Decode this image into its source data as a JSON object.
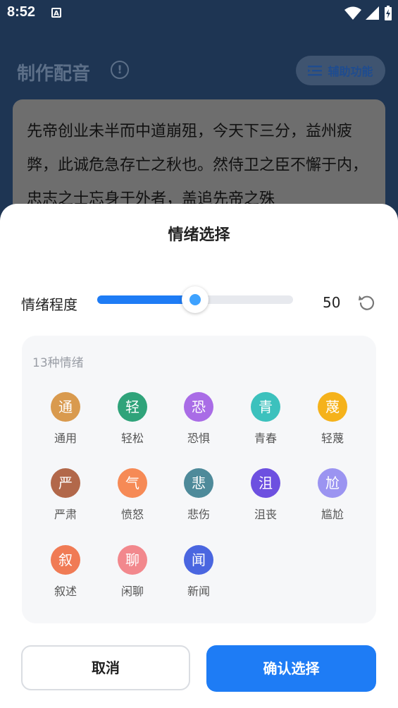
{
  "status_bar": {
    "time": "8:52",
    "notification_letter": "A"
  },
  "header": {
    "title": "制作配音",
    "assist_label": "辅助功能"
  },
  "script": {
    "text": "先帝创业未半而中道崩殂，今天下三分，益州疲弊，此诚危急存亡之秋也。然侍卫之臣不懈于内，忠志之士忘身于外者，盖追先帝之殊"
  },
  "sheet": {
    "title": "情绪选择",
    "intensity_label": "情绪程度",
    "intensity_value": "50",
    "intensity_fraction": 0.5,
    "emotion_count": "13种情绪",
    "emotions": [
      {
        "char": "通",
        "label": "通用",
        "color": "#d99a4e"
      },
      {
        "char": "轻",
        "label": "轻松",
        "color": "#2fa37a"
      },
      {
        "char": "恐",
        "label": "恐惧",
        "color": "#a96ce6"
      },
      {
        "char": "青",
        "label": "青春",
        "color": "#3cc1bd"
      },
      {
        "char": "蔑",
        "label": "轻蔑",
        "color": "#f5b21b"
      },
      {
        "char": "严",
        "label": "严肃",
        "color": "#b2684a"
      },
      {
        "char": "气",
        "label": "愤怒",
        "color": "#f68a56"
      },
      {
        "char": "悲",
        "label": "悲伤",
        "color": "#4e8a9a"
      },
      {
        "char": "沮",
        "label": "沮丧",
        "color": "#6d50e0"
      },
      {
        "char": "尬",
        "label": "尴尬",
        "color": "#9b94f1"
      },
      {
        "char": "叙",
        "label": "叙述",
        "color": "#f07b55"
      },
      {
        "char": "聊",
        "label": "闲聊",
        "color": "#f2888d"
      },
      {
        "char": "闻",
        "label": "新闻",
        "color": "#4a66e0"
      }
    ],
    "cancel_label": "取消",
    "confirm_label": "确认选择"
  }
}
